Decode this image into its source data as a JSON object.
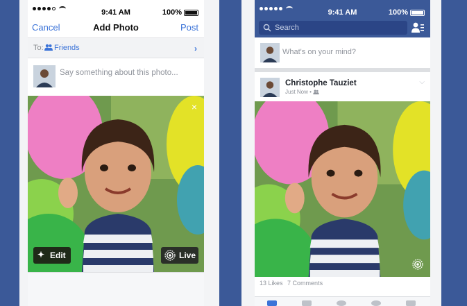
{
  "colors": {
    "background": "#3b5998",
    "facebook_blue": "#3b5998",
    "link_blue": "#3b73d8",
    "grey_text": "#90949c"
  },
  "left_phone": {
    "status_bar": {
      "time": "9:41 AM",
      "battery": "100%"
    },
    "nav": {
      "cancel": "Cancel",
      "title": "Add Photo",
      "post": "Post"
    },
    "audience": {
      "to_label": "To:",
      "icon": "friends-icon",
      "value": "Friends"
    },
    "compose": {
      "placeholder": "Say something about this photo..."
    },
    "photo": {
      "close_icon": "×",
      "edit_button": "Edit",
      "live_button": "Live"
    }
  },
  "right_phone": {
    "status_bar": {
      "time": "9:41 AM",
      "battery": "100%"
    },
    "header": {
      "search_placeholder": "Search",
      "friend_requests_icon": "friend-requests-icon"
    },
    "composer": {
      "placeholder": "What's on your mind?"
    },
    "post": {
      "author": "Christophe Tauziet",
      "time": "Just Now •",
      "likes": "13 Likes",
      "comments": "7 Comments"
    },
    "tabbar": [
      "news-feed-icon",
      "requests-icon",
      "messenger-icon",
      "notifications-icon",
      "more-icon"
    ]
  }
}
